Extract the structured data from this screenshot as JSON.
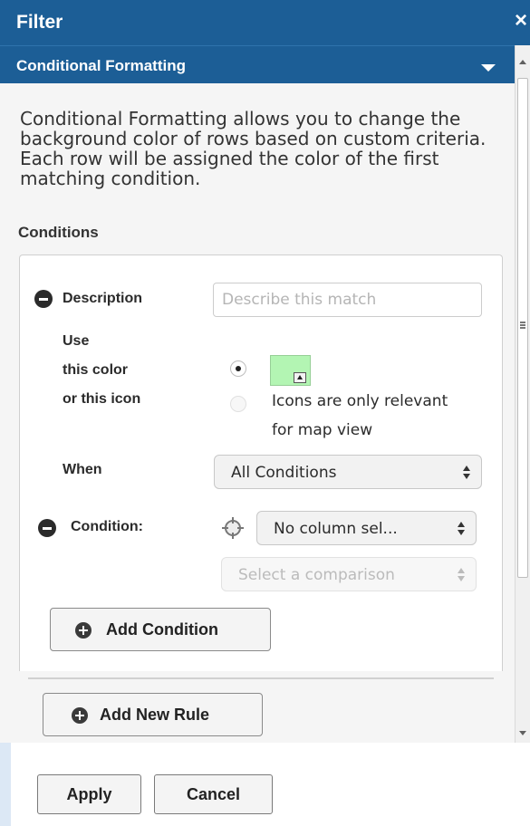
{
  "window": {
    "title": "Filter",
    "close_glyph": "×"
  },
  "section": {
    "title": "Conditional Formatting"
  },
  "intro": {
    "text": "Conditional Formatting allows you to change the background color of rows based on custom criteria. Each row will be assigned the color of the first matching condition."
  },
  "conditions": {
    "heading": "Conditions"
  },
  "rule": {
    "description_label": "Description",
    "description_value": "",
    "description_placeholder": "Describe this match",
    "use_label": "Use",
    "color_label": "this color",
    "icon_label": "or this icon",
    "color_option_selected": true,
    "icon_option_enabled": false,
    "swatch_color": "#b3f5b3",
    "icon_note_line1": "Icons are only relevant",
    "icon_note_line2": "for map view",
    "when_label": "When",
    "when_value": "All Conditions",
    "condition_label": "Condition:",
    "column_value": "No column sel...",
    "comparison_placeholder": "Select a comparison",
    "add_condition_label": "Add Condition"
  },
  "add_rule_label": "Add New Rule",
  "footer": {
    "apply_label": "Apply",
    "cancel_label": "Cancel"
  },
  "colors": {
    "header_bg": "#1c5e96",
    "swatch": "#b3f5b3"
  }
}
